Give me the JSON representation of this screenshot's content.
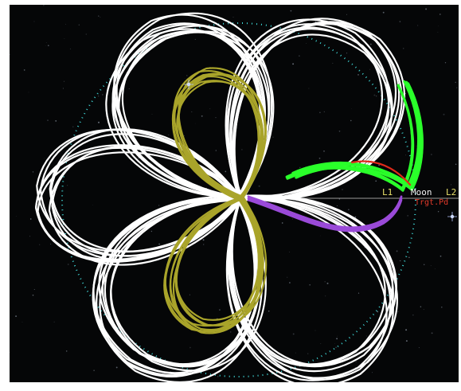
{
  "scene": {
    "labels": {
      "l1": "L1",
      "moon": "Moon",
      "l2": "L2",
      "target": "Trgt.Pd"
    },
    "colors": {
      "background": "#050607",
      "orbit_main": "#ffffff",
      "orbit_olive": "#a9a42a",
      "orbit_green": "#2aff2a",
      "orbit_purple": "#9a4ad8",
      "orbit_red": "#e02a1a",
      "moon_orbit_ring": "#3fd6d6",
      "axis_line": "#9a9a9a"
    },
    "icons": [
      "star-icon",
      "star-icon"
    ]
  }
}
